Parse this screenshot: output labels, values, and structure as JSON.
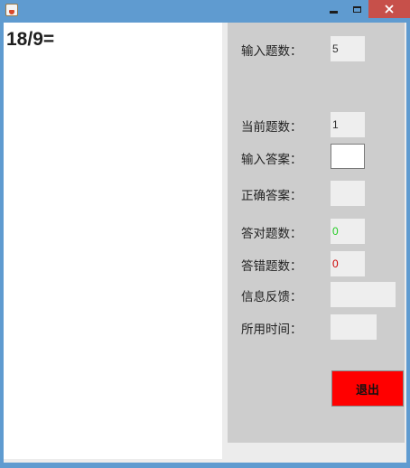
{
  "window": {
    "title": "",
    "icon": "java-cup-icon"
  },
  "question": {
    "text": "18/9="
  },
  "form": {
    "total_label": "输入题数：",
    "total_value": "5",
    "current_label": "当前题数：",
    "current_value": "1",
    "answer_label": "输入答案：",
    "answer_value": "",
    "correct_answer_label": "正确答案：",
    "correct_answer_value": "",
    "right_count_label": "答对题数：",
    "right_count_value": "0",
    "wrong_count_label": "答错题数：",
    "wrong_count_value": "0",
    "feedback_label": "信息反馈：",
    "feedback_value": "",
    "time_label": "所用时间：",
    "time_value": ""
  },
  "buttons": {
    "exit_label": "退出"
  },
  "colors": {
    "right_count": "#22cc22",
    "wrong_count": "#cc0000",
    "exit_bg": "#ff0000",
    "panel_bg": "#cdcdcd",
    "titlebar_bg": "#5f9bd0",
    "close_bg": "#c7504a"
  }
}
